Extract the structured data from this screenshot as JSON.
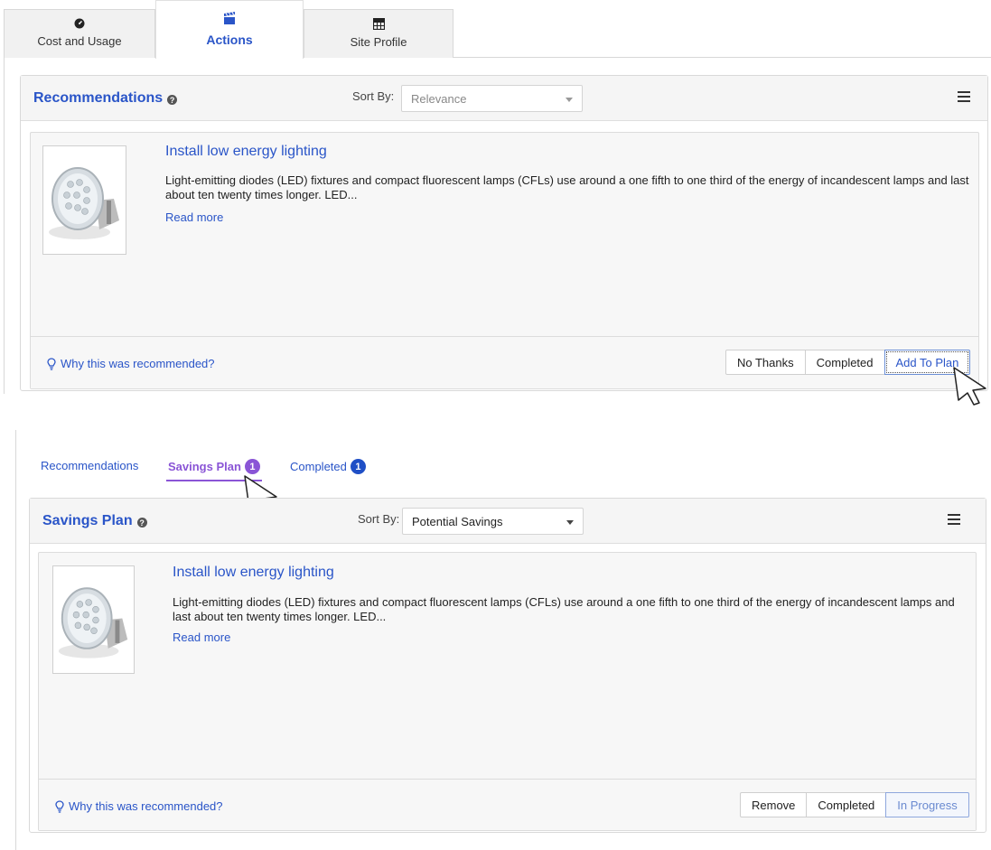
{
  "top_tabs": [
    {
      "label": "Cost and Usage",
      "icon": "gauge-icon",
      "active": false
    },
    {
      "label": "Actions",
      "icon": "clapperboard-icon",
      "active": true
    },
    {
      "label": "Site Profile",
      "icon": "grid-icon",
      "active": false
    }
  ],
  "recommendations_panel": {
    "title": "Recommendations",
    "sort_label": "Sort By:",
    "sort_value": "Relevance",
    "card": {
      "title": "Install low energy lighting",
      "description": "Light-emitting diodes (LED) fixtures and compact fluorescent lamps (CFLs) use around a one fifth to one third of the energy of incandescent lamps and last about ten twenty times longer. LED...",
      "read_more": "Read more",
      "why": "Why this was recommended?",
      "buttons": [
        "No Thanks",
        "Completed",
        "Add To Plan"
      ]
    }
  },
  "sub_tabs": [
    {
      "label": "Recommendations",
      "badge": null
    },
    {
      "label": "Savings Plan",
      "badge": "1"
    },
    {
      "label": "Completed",
      "badge": "1"
    }
  ],
  "savings_panel": {
    "title": "Savings Plan",
    "sort_label": "Sort By:",
    "sort_value": "Potential Savings",
    "card": {
      "title": "Install low energy lighting",
      "description": "Light-emitting diodes (LED) fixtures and compact fluorescent lamps (CFLs) use around a one fifth to one third of the energy of incandescent lamps and last about ten twenty times longer. LED...",
      "read_more": "Read more",
      "why": "Why this was recommended?",
      "buttons": [
        "Remove",
        "Completed",
        "In Progress"
      ]
    }
  },
  "colors": {
    "link": "#2a55c8",
    "active_subtab": "#8a55d6",
    "badge_blue": "#1f4fc6"
  }
}
